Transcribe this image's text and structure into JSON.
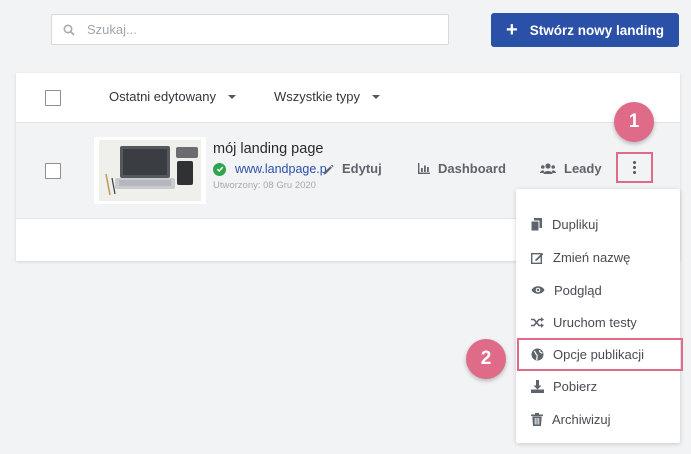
{
  "search": {
    "placeholder": "Szukaj..."
  },
  "toolbar": {
    "create_label": "Stwórz nowy landing"
  },
  "filters": {
    "sort_label": "Ostatni edytowany",
    "type_label": "Wszystkie typy"
  },
  "landing": {
    "title": "mój landing page",
    "url": "www.landpage.p",
    "created": "Utworzony: 08 Gru 2020"
  },
  "actions": {
    "edit": "Edytuj",
    "dashboard": "Dashboard",
    "leads": "Leady"
  },
  "badges": {
    "one": "1",
    "two": "2"
  },
  "menu": {
    "items": [
      {
        "label": "Duplikuj",
        "icon": "copy-icon"
      },
      {
        "label": "Zmień nazwę",
        "icon": "edit-icon"
      },
      {
        "label": "Podgląd",
        "icon": "eye-icon"
      },
      {
        "label": "Uruchom testy",
        "icon": "shuffle-icon"
      },
      {
        "label": "Opcje publikacji",
        "icon": "globe-icon"
      },
      {
        "label": "Pobierz",
        "icon": "download-icon"
      },
      {
        "label": "Archiwizuj",
        "icon": "trash-icon"
      }
    ]
  },
  "colors": {
    "primary": "#2b50a8",
    "highlight": "#e06b88",
    "success": "#2ea44f"
  }
}
